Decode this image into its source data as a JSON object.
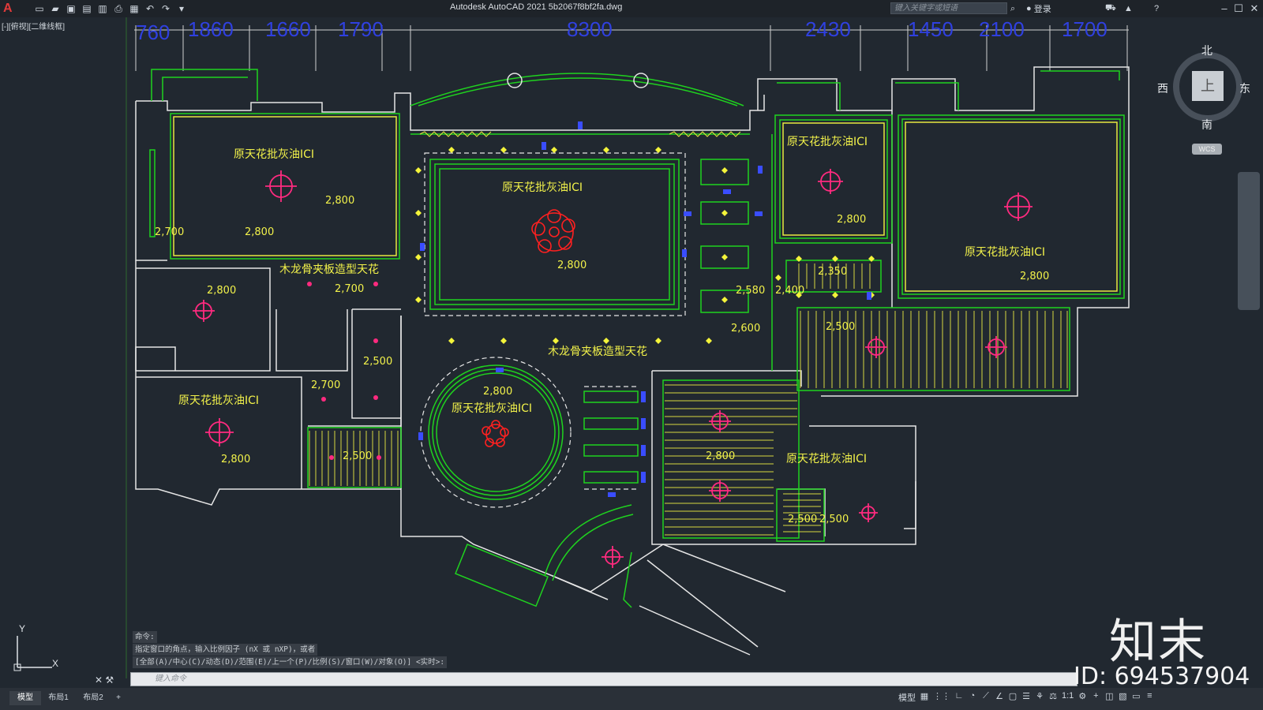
{
  "window": {
    "title": "Autodesk AutoCAD 2021    5b2067f8bf2fa.dwg",
    "search_placeholder": "键入关键字或短语",
    "login_label": "登录"
  },
  "viewport": {
    "label": "[-][俯视][二维线框]"
  },
  "dimensions_top": [
    "760",
    "1860",
    "1660",
    "1790",
    "8300",
    "2430",
    "1450",
    "2100",
    "1700"
  ],
  "room_labels": {
    "ceiling_a": "原天花批灰油ICI",
    "ceiling_b": "原天花批灰油ICI",
    "ceiling_c": "原天花批灰油ICI",
    "ceiling_d": "原天花批灰油ICI",
    "ceiling_e": "原天花批灰油ICI",
    "ceiling_f": "原天花批灰油ICI",
    "ceiling_g": "原天花批灰油ICI",
    "wood_ceiling_a": "木龙骨夹板造型天花",
    "wood_ceiling_b": "木龙骨夹板造型天花"
  },
  "elevations": [
    "2,800",
    "2,700",
    "2,800",
    "2,800",
    "2,700",
    "2,800",
    "2,500",
    "2,700",
    "2,800",
    "2,500",
    "2,800",
    "2,800",
    "2,580",
    "2,400",
    "2,600",
    "2,350",
    "2,800",
    "2,500",
    "2,800",
    "2,500",
    "2,500"
  ],
  "viewcube": {
    "north": "北",
    "south": "南",
    "east": "东",
    "west": "西",
    "face": "上",
    "wcs": "WCS"
  },
  "command_line": {
    "history": [
      "命令:",
      "指定窗口的角点，输入比例因子 (nX 或 nXP)，或者",
      "[全部(A)/中心(C)/动态(D)/范围(E)/上一个(P)/比例(S)/窗口(W)/对象(O)] <实时>:"
    ],
    "input_placeholder": "键入命令"
  },
  "layout_tabs": [
    "模型",
    "布局1",
    "布局2",
    "+"
  ],
  "status": {
    "model_label": "模型",
    "scale": "1:1"
  },
  "ucs": {
    "x": "X",
    "y": "Y"
  },
  "watermark": {
    "logo": "知末",
    "id": "ID: 694537904"
  },
  "colors": {
    "background": "#212830",
    "wall": "#e6e6e6",
    "green_line": "#1fd21f",
    "yellow_line": "#e8e840",
    "magenta": "#ff2a7f",
    "red_fixture": "#ff2a2a",
    "dim_text": "#3a4dff"
  }
}
